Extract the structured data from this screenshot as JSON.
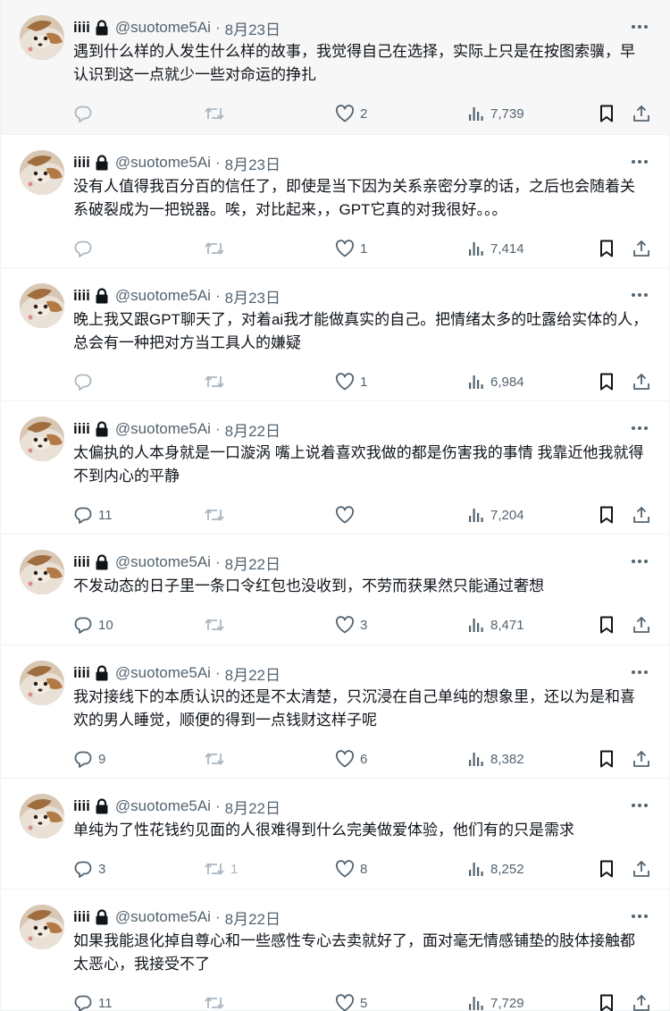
{
  "tweets": [
    {
      "name": "iiii",
      "handle": "@suotome5Ai",
      "dot": "·",
      "date": "8月23日",
      "text": "遇到什么样的人发生什么样的故事，我觉得自己在选择，实际上只是在按图索骥，早认识到这一点就少一些对命运的挣扎",
      "replies": "",
      "retweets": "",
      "likes": "2",
      "views": "7,739",
      "reply_icon_faint": true,
      "highlighted": true
    },
    {
      "name": "iiii",
      "handle": "@suotome5Ai",
      "dot": "·",
      "date": "8月23日",
      "text": "没有人值得我百分百的信任了，即使是当下因为关系亲密分享的话，之后也会随着关系破裂成为一把锐器。唉，对比起来，，GPT它真的对我很好。。。",
      "replies": "",
      "retweets": "",
      "likes": "1",
      "views": "7,414",
      "reply_icon_faint": true,
      "highlighted": false
    },
    {
      "name": "iiii",
      "handle": "@suotome5Ai",
      "dot": "·",
      "date": "8月23日",
      "text": "晚上我又跟GPT聊天了，对着ai我才能做真实的自己。把情绪太多的吐露给实体的人，总会有一种把对方当工具人的嫌疑",
      "replies": "",
      "retweets": "",
      "likes": "1",
      "views": "6,984",
      "reply_icon_faint": true,
      "highlighted": false
    },
    {
      "name": "iiii",
      "handle": "@suotome5Ai",
      "dot": "·",
      "date": "8月22日",
      "text": "太偏执的人本身就是一口漩涡 嘴上说着喜欢我做的都是伤害我的事情 我靠近他我就得不到内心的平静",
      "replies": "11",
      "retweets": "",
      "likes": "",
      "views": "7,204",
      "reply_icon_faint": false,
      "highlighted": false
    },
    {
      "name": "iiii",
      "handle": "@suotome5Ai",
      "dot": "·",
      "date": "8月22日",
      "text": "不发动态的日子里一条口令红包也没收到，不劳而获果然只能通过奢想",
      "replies": "10",
      "retweets": "",
      "likes": "3",
      "views": "8,471",
      "reply_icon_faint": false,
      "highlighted": false
    },
    {
      "name": "iiii",
      "handle": "@suotome5Ai",
      "dot": "·",
      "date": "8月22日",
      "text": "我对接线下的本质认识的还是不太清楚，只沉浸在自己单纯的想象里，还以为是和喜欢的男人睡觉，顺便的得到一点钱财这样子呢",
      "replies": "9",
      "retweets": "",
      "likes": "6",
      "views": "8,382",
      "reply_icon_faint": false,
      "highlighted": false
    },
    {
      "name": "iiii",
      "handle": "@suotome5Ai",
      "dot": "·",
      "date": "8月22日",
      "text": "单纯为了性花钱约见面的人很难得到什么完美做爱体验，他们有的只是需求",
      "replies": "3",
      "retweets": "1",
      "likes": "8",
      "views": "8,252",
      "reply_icon_faint": false,
      "highlighted": false
    },
    {
      "name": "iiii",
      "handle": "@suotome5Ai",
      "dot": "·",
      "date": "8月22日",
      "text": "如果我能退化掉自尊心和一些感性专心去卖就好了，面对毫无情感铺垫的肢体接触都太恶心，我接受不了",
      "replies": "11",
      "retweets": "",
      "likes": "5",
      "views": "7,729",
      "reply_icon_faint": false,
      "highlighted": false
    }
  ],
  "icons": {
    "lock": "lock-icon",
    "more": "more-icon",
    "reply": "reply-icon",
    "retweet": "retweet-icon",
    "like": "like-icon",
    "views": "views-icon",
    "bookmark": "bookmark-icon",
    "share": "share-icon"
  },
  "colors": {
    "text": "#0f1419",
    "secondary": "#536471",
    "divider": "#eff3f4",
    "highlight_bg": "#f7f7f7"
  }
}
